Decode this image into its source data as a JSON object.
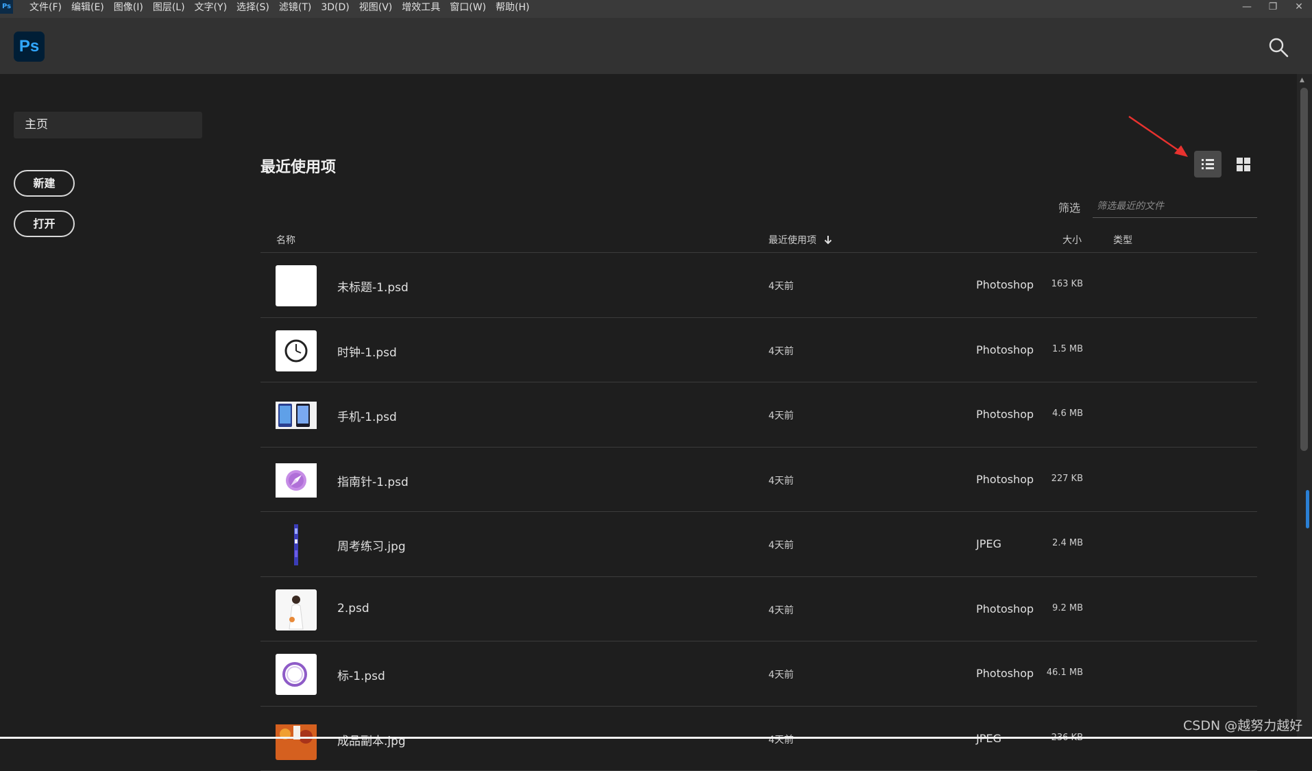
{
  "menubar": {
    "app_icon": "Ps",
    "items": [
      "文件(F)",
      "编辑(E)",
      "图像(I)",
      "图层(L)",
      "文字(Y)",
      "选择(S)",
      "滤镜(T)",
      "3D(D)",
      "视图(V)",
      "增效工具",
      "窗口(W)",
      "帮助(H)"
    ],
    "window_controls": [
      "minimize-icon",
      "restore-icon",
      "close-icon"
    ]
  },
  "header": {
    "logo": "Ps",
    "search_icon": "search-icon"
  },
  "sidebar": {
    "home": "主页",
    "new_button": "新建",
    "open_button": "打开"
  },
  "main": {
    "title": "最近使用项",
    "view_list_icon": "list-view-icon",
    "view_grid_icon": "grid-view-icon",
    "filter": {
      "label": "筛选",
      "placeholder": "筛选最近的文件"
    },
    "columns": {
      "name": "名称",
      "recent": "最近使用项",
      "size": "大小",
      "type": "类型"
    },
    "files": [
      {
        "name": "未标题-1.psd",
        "date": "4天前",
        "size": "163 KB",
        "type": "Photoshop",
        "thumb": "blank-white"
      },
      {
        "name": "时钟-1.psd",
        "date": "4天前",
        "size": "1.5 MB",
        "type": "Photoshop",
        "thumb": "clock"
      },
      {
        "name": "手机-1.psd",
        "date": "4天前",
        "size": "4.6 MB",
        "type": "Photoshop",
        "thumb": "phones"
      },
      {
        "name": "指南针-1.psd",
        "date": "4天前",
        "size": "227 KB",
        "type": "Photoshop",
        "thumb": "compass"
      },
      {
        "name": "周考练习.jpg",
        "date": "4天前",
        "size": "2.4 MB",
        "type": "JPEG",
        "thumb": "tall-strip"
      },
      {
        "name": "2.psd",
        "date": "4天前",
        "size": "9.2 MB",
        "type": "Photoshop",
        "thumb": "bride"
      },
      {
        "name": "标-1.psd",
        "date": "4天前",
        "size": "46.1 MB",
        "type": "Photoshop",
        "thumb": "purple-ring"
      },
      {
        "name": "成品副本.jpg",
        "date": "4天前",
        "size": "236 KB",
        "type": "JPEG",
        "thumb": "autumn"
      }
    ]
  },
  "colors": {
    "background": "#1e1e1e",
    "header": "#323232",
    "menubar": "#3a3a3a",
    "ps_blue": "#31a8ff",
    "annotation_red": "#e8322f"
  },
  "watermark": "CSDN @越努力越好"
}
